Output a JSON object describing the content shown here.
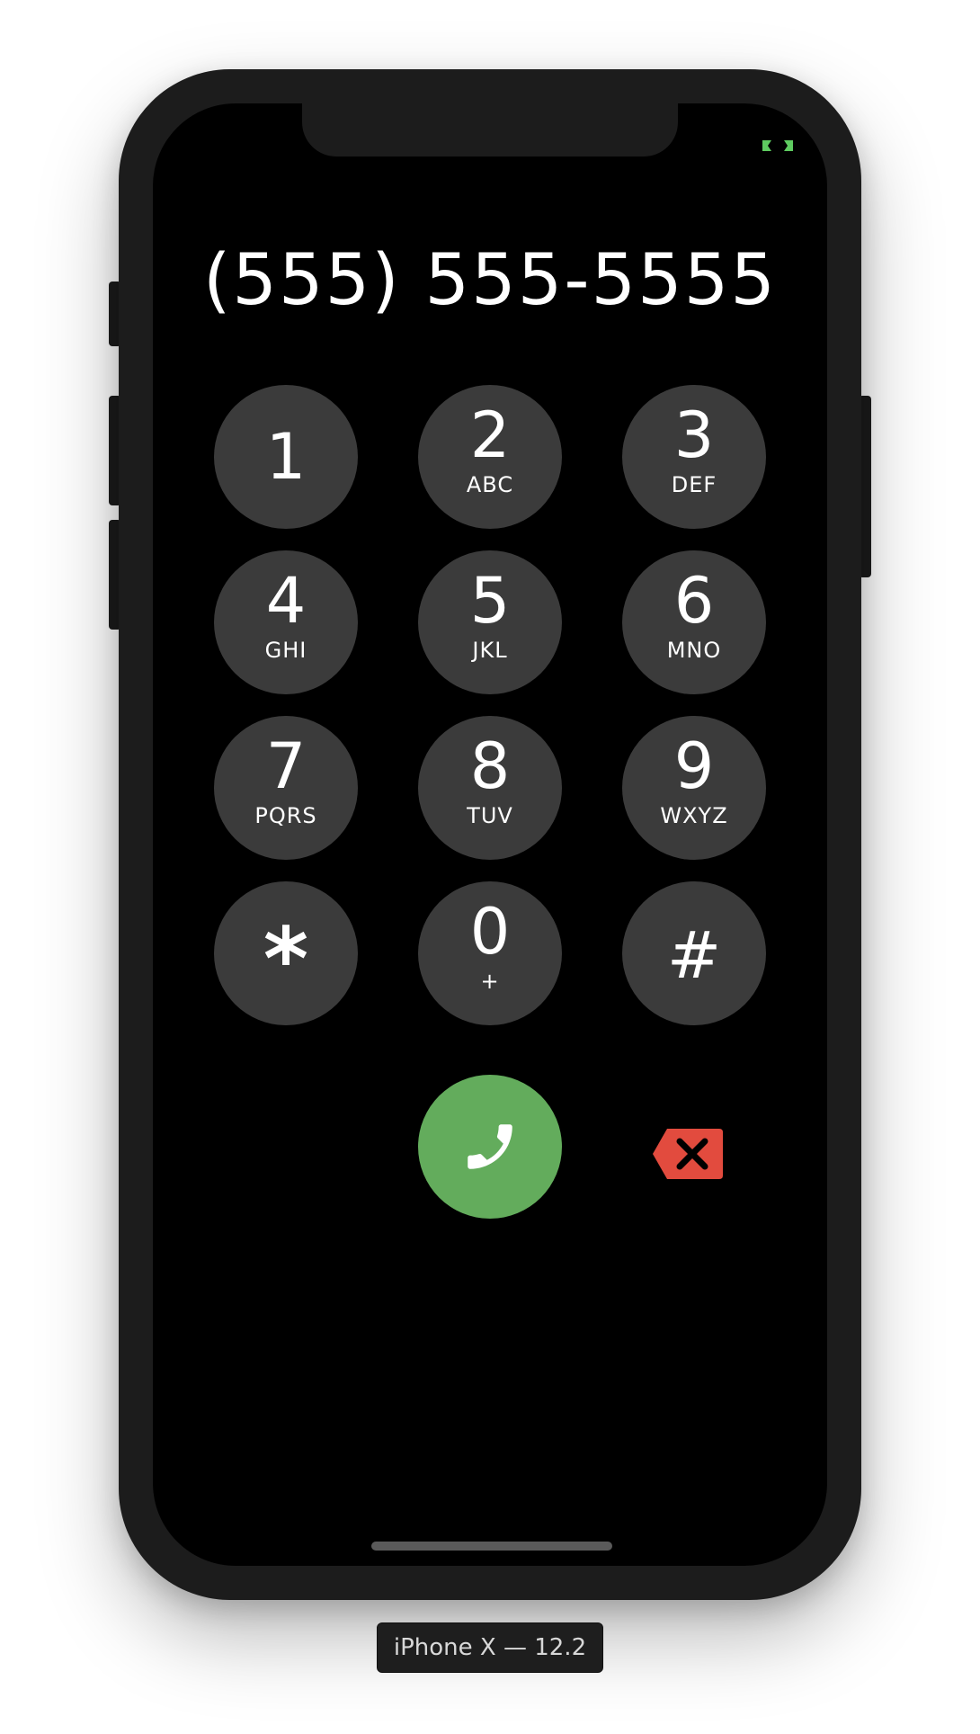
{
  "device": {
    "label": "iPhone X — 12.2"
  },
  "dialer": {
    "number": "(555) 555-5555",
    "keys": [
      {
        "digit": "1",
        "letters": ""
      },
      {
        "digit": "2",
        "letters": "ABC"
      },
      {
        "digit": "3",
        "letters": "DEF"
      },
      {
        "digit": "4",
        "letters": "GHI"
      },
      {
        "digit": "5",
        "letters": "JKL"
      },
      {
        "digit": "6",
        "letters": "MNO"
      },
      {
        "digit": "7",
        "letters": "PQRS"
      },
      {
        "digit": "8",
        "letters": "TUV"
      },
      {
        "digit": "9",
        "letters": "WXYZ"
      },
      {
        "digit": "*",
        "letters": ""
      },
      {
        "digit": "0",
        "letters": "+"
      },
      {
        "digit": "#",
        "letters": ""
      }
    ],
    "call_icon": "phone-icon",
    "delete_icon": "backspace-icon"
  },
  "colors": {
    "key_background": "#3b3b3b",
    "call_green": "#63ac5c",
    "delete_red": "#e24b3e",
    "status_green": "#5ecb60"
  }
}
